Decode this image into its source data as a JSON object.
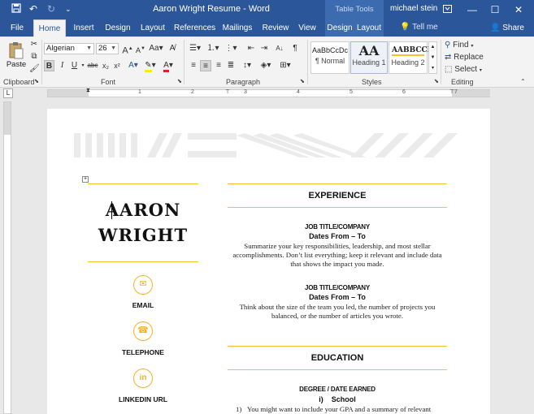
{
  "titlebar": {
    "document_title": "Aaron Wright Resume - Word",
    "context_label": "Table Tools",
    "user": "michael stein",
    "save_icon": "save-icon",
    "undo_icon": "undo-icon",
    "redo_icon": "redo-icon",
    "customize_icon": "customize-qat-icon"
  },
  "menu": {
    "tabs": [
      "File",
      "Home",
      "Insert",
      "Design",
      "Layout",
      "References",
      "Mailings",
      "Review",
      "View",
      "Design",
      "Layout"
    ],
    "active": "Home",
    "tell_me": "Tell me",
    "share": "Share"
  },
  "ribbon": {
    "clipboard": {
      "paste": "Paste",
      "label": "Clipboard"
    },
    "font": {
      "name": "Algerian",
      "size": "26",
      "label": "Font"
    },
    "paragraph": {
      "label": "Paragraph"
    },
    "styles": {
      "label": "Styles",
      "items": [
        {
          "sample": "AaBbCcDc",
          "name": "¶ Normal"
        },
        {
          "sample": "AA",
          "name": "Heading 1"
        },
        {
          "sample": "AABBCCI",
          "name": "Heading 2"
        }
      ]
    },
    "editing": {
      "find": "Find",
      "replace": "Replace",
      "select": "Select",
      "label": "Editing"
    }
  },
  "ruler": {
    "numbers": [
      "1",
      "2",
      "3",
      "4",
      "5",
      "6",
      "7"
    ]
  },
  "document": {
    "first_name": "AARON",
    "last_name": "WRIGHT",
    "contacts": [
      {
        "icon": "email-icon",
        "label": "EMAIL"
      },
      {
        "icon": "telephone-icon",
        "label": "TELEPHONE"
      },
      {
        "icon": "linkedin-icon",
        "label": "LINKEDIN URL"
      }
    ],
    "experience": {
      "title": "EXPERIENCE",
      "jobs": [
        {
          "title": "JOB TITLE/COMPANY",
          "dates": "Dates From – To",
          "text": "Summarize your key responsibilities, leadership, and most stellar accomplishments. Don’t list everything; keep it relevant and include data that shows the impact you made."
        },
        {
          "title": "JOB TITLE/COMPANY",
          "dates": "Dates From – To",
          "text": "Think about the size of the team you led, the number of projects you balanced, or the number of articles you wrote."
        }
      ]
    },
    "education": {
      "title": "EDUCATION",
      "degree": "DEGREE / DATE EARNED",
      "school_marker": "i)",
      "school": "School",
      "list_marker": "1)",
      "list_text": "You might want to include your GPA and a summary of relevant"
    }
  },
  "colors": {
    "accent": "#f5c035",
    "word_blue": "#2b579a"
  }
}
